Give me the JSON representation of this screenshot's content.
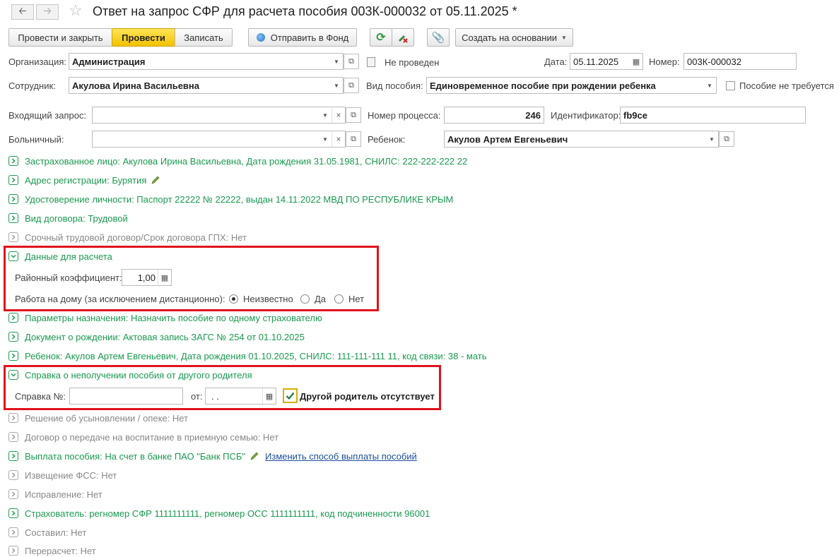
{
  "title": "Ответ на запрос СФР для расчета пособия 003К-000032 от 05.11.2025 *",
  "toolbar": {
    "post_close": "Провести и закрыть",
    "post": "Провести",
    "save": "Записать",
    "send_fund": "Отправить в Фонд",
    "create_based": "Создать на основании"
  },
  "header": {
    "org_label": "Организация:",
    "org_value": "Администрация",
    "status": "Не проведен",
    "date_label": "Дата:",
    "date_value": "05.11.2025",
    "number_label": "Номер:",
    "number_value": "003К-000032",
    "employee_label": "Сотрудник:",
    "employee_value": "Акулова Ирина Васильевна",
    "benefit_type_label": "Вид пособия:",
    "benefit_type_value": "Единовременное пособие при рождении ребенка",
    "not_required_label": "Пособие не требуется",
    "incoming_label": "Входящий запрос:",
    "incoming_value": "",
    "process_label": "Номер процесса:",
    "process_value": "246",
    "ident_label": "Идентификатор:",
    "ident_value": "fb9ce",
    "sick_label": "Больничный:",
    "sick_value": "",
    "child_label": "Ребенок:",
    "child_value": "Акулов Артем Евгеньевич"
  },
  "sections": {
    "insured": "Застрахованное лицо: Акулова Ирина Васильевна, Дата рождения 31.05.1981, СНИЛС: 222-222-222 22",
    "address": "Адрес регистрации: Бурятия",
    "identity": "Удостоверение личности: Паспорт 22222 № 22222, выдан 14.11.2022 МВД ПО РЕСПУБЛИКЕ КРЫМ",
    "contract": "Вид договора: Трудовой",
    "fixed_term": "Срочный трудовой договор/Срок договора ГПХ: Нет",
    "calc_data": "Данные для расчета",
    "regional_coef_label": "Районный коэффициент:",
    "regional_coef_value": "1,00",
    "home_work_label": "Работа на дому (за исключением дистанционно):",
    "radio_unknown": "Неизвестно",
    "radio_yes": "Да",
    "radio_no": "Нет",
    "assign_params": "Параметры назначения: Назначить пособие по одному страхователю",
    "birth_doc": "Документ о рождении: Актовая запись ЗАГС № 254 от 01.10.2025",
    "child": "Ребенок: Акулов Артем Евгеньевич, Дата рождения 01.10.2025, СНИЛС: 111-111-111 11, код связи: 38 - мать",
    "certificate": "Справка о неполучении пособия от другого родителя",
    "cert_no_label": "Справка №:",
    "cert_no_value": "",
    "cert_from_label": "от:",
    "cert_date_value": " .  .",
    "other_parent_absent": "Другой родитель отсутствует",
    "adoption": "Решение об усыновлении / опеке: Нет",
    "foster": "Договор о передаче на воспитание в приемную семью: Нет",
    "payment": "Выплата пособия: На счет в банке ПАО \"Банк ПСБ\"",
    "payment_link": "Изменить способ выплаты пособий",
    "fss_notice": "Извещение ФСС: Нет",
    "correction": "Исправление: Нет",
    "insurer": "Страхователь: регномер СФР 1111111111, регномер ОСС 1111111111, код подчиненности 96001",
    "composed": "Составил: Нет",
    "recalc": "Перерасчет: Нет"
  },
  "colors": {
    "accent_green": "#1a9a4f",
    "highlight_red": "#e0121b",
    "post_yellow": "#f2c200"
  }
}
